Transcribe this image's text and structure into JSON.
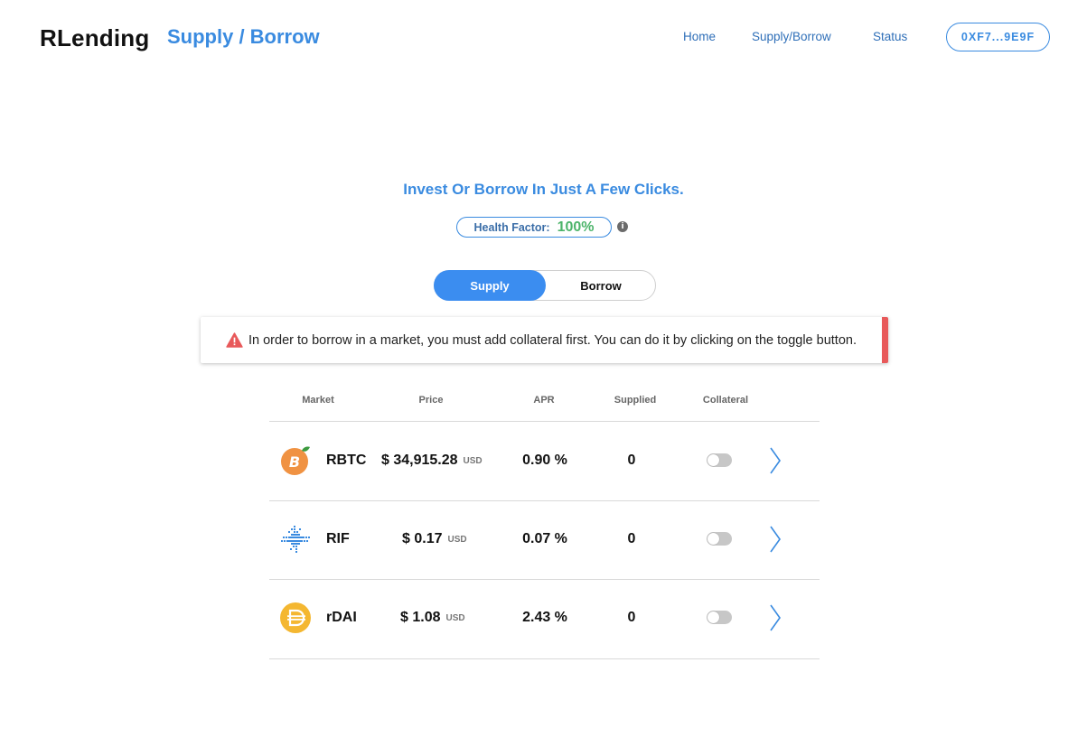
{
  "header": {
    "brand": "RLending",
    "page_title": "Supply / Borrow",
    "nav": {
      "home": "Home",
      "supply_borrow": "Supply/Borrow",
      "status": "Status"
    },
    "wallet": "0XF7...9E9F"
  },
  "hero": {
    "tagline": "Invest Or Borrow In Just A Few Clicks.",
    "health_label": "Health Factor:",
    "health_value": "100%",
    "info_icon": "i"
  },
  "mode_toggle": {
    "supply": "Supply",
    "borrow": "Borrow",
    "selected": "Supply"
  },
  "alert": {
    "icon": "warning-triangle-icon",
    "text": "In order to borrow in a market, you must add collateral first. You can do it by clicking on the toggle button."
  },
  "table": {
    "columns": [
      "Market",
      "Price",
      "APR",
      "Supplied",
      "Collateral"
    ],
    "rows": [
      {
        "name": "RBTC",
        "icon": "rbtc-icon",
        "price": "$ 34,915.28",
        "unit": "USD",
        "apr": "0.90 %",
        "supplied": "0",
        "collateral": false
      },
      {
        "name": "RIF",
        "icon": "rif-icon",
        "price": "$ 0.17",
        "unit": "USD",
        "apr": "0.07 %",
        "supplied": "0",
        "collateral": false
      },
      {
        "name": "rDAI",
        "icon": "rdai-icon",
        "price": "$ 1.08",
        "unit": "USD",
        "apr": "2.43 %",
        "supplied": "0",
        "collateral": false
      }
    ]
  },
  "colors": {
    "accent": "#3a8be0",
    "active_toggle": "#3b8df0",
    "health_ok": "#4cb46a",
    "alert": "#e8595a",
    "rbtc": "#f09242",
    "rdai": "#f4b731",
    "rif": "#3a8be0"
  }
}
